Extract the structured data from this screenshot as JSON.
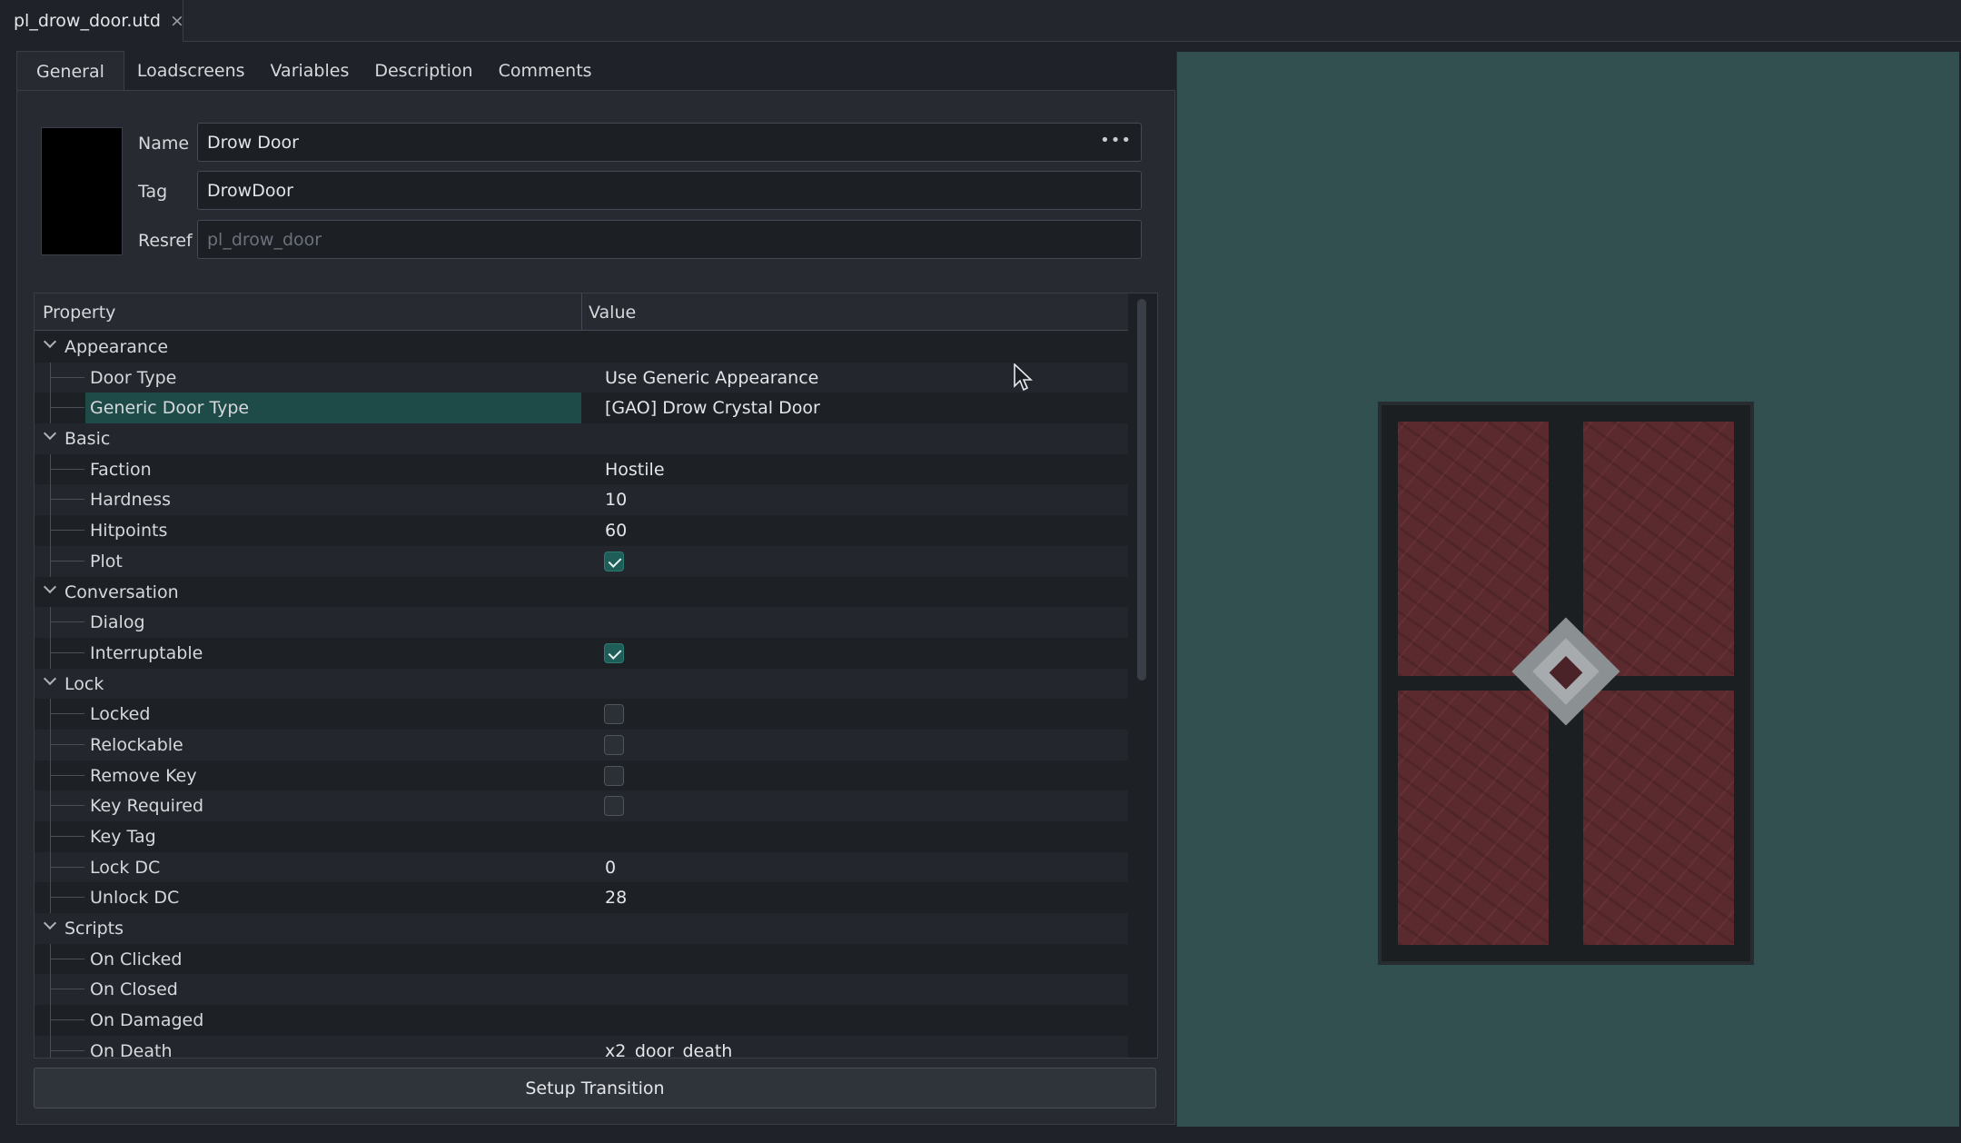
{
  "document_tab": {
    "title": "pl_drow_door.utd",
    "close_glyph": "×"
  },
  "subtabs": [
    "General",
    "Loadscreens",
    "Variables",
    "Description",
    "Comments"
  ],
  "fields": {
    "name_label": "Name",
    "name_value": "Drow Door",
    "tag_label": "Tag",
    "tag_value": "DrowDoor",
    "resref_label": "Resref",
    "resref_placeholder": "pl_drow_door"
  },
  "grid": {
    "col_property": "Property",
    "col_value": "Value",
    "rows": [
      {
        "type": "cat",
        "label": "Appearance"
      },
      {
        "type": "leaf",
        "label": "Door Type",
        "value": "Use Generic Appearance"
      },
      {
        "type": "leaf",
        "label": "Generic Door Type",
        "value": "[GAO] Drow Crystal Door",
        "selected": true
      },
      {
        "type": "cat",
        "label": "Basic"
      },
      {
        "type": "leaf",
        "label": "Faction",
        "value": "Hostile"
      },
      {
        "type": "leaf",
        "label": "Hardness",
        "value": "10"
      },
      {
        "type": "leaf",
        "label": "Hitpoints",
        "value": "60"
      },
      {
        "type": "leaf",
        "label": "Plot",
        "checkbox": true,
        "checked": true
      },
      {
        "type": "cat",
        "label": "Conversation"
      },
      {
        "type": "leaf",
        "label": "Dialog",
        "value": ""
      },
      {
        "type": "leaf",
        "label": "Interruptable",
        "checkbox": true,
        "checked": true
      },
      {
        "type": "cat",
        "label": "Lock"
      },
      {
        "type": "leaf",
        "label": "Locked",
        "checkbox": true,
        "checked": false
      },
      {
        "type": "leaf",
        "label": "Relockable",
        "checkbox": true,
        "checked": false
      },
      {
        "type": "leaf",
        "label": "Remove Key",
        "checkbox": true,
        "checked": false
      },
      {
        "type": "leaf",
        "label": "Key Required",
        "checkbox": true,
        "checked": false
      },
      {
        "type": "leaf",
        "label": "Key Tag",
        "value": ""
      },
      {
        "type": "leaf",
        "label": "Lock DC",
        "value": "0"
      },
      {
        "type": "leaf",
        "label": "Unlock DC",
        "value": "28"
      },
      {
        "type": "cat",
        "label": "Scripts"
      },
      {
        "type": "leaf",
        "label": "On Clicked",
        "value": ""
      },
      {
        "type": "leaf",
        "label": "On Closed",
        "value": ""
      },
      {
        "type": "leaf",
        "label": "On Damaged",
        "value": ""
      },
      {
        "type": "leaf",
        "label": "On Death",
        "value": "x2_door_death"
      }
    ]
  },
  "buttons": {
    "setup_transition": "Setup Transition"
  },
  "colors": {
    "accent_selection": "#1e4a48",
    "preview_background": "#335050",
    "checkbox_on": "#1f5e58"
  },
  "icons": {
    "more": "ellipsis-icon",
    "chevron": "chevron-down-icon",
    "cursor": "mouse-cursor-icon"
  }
}
